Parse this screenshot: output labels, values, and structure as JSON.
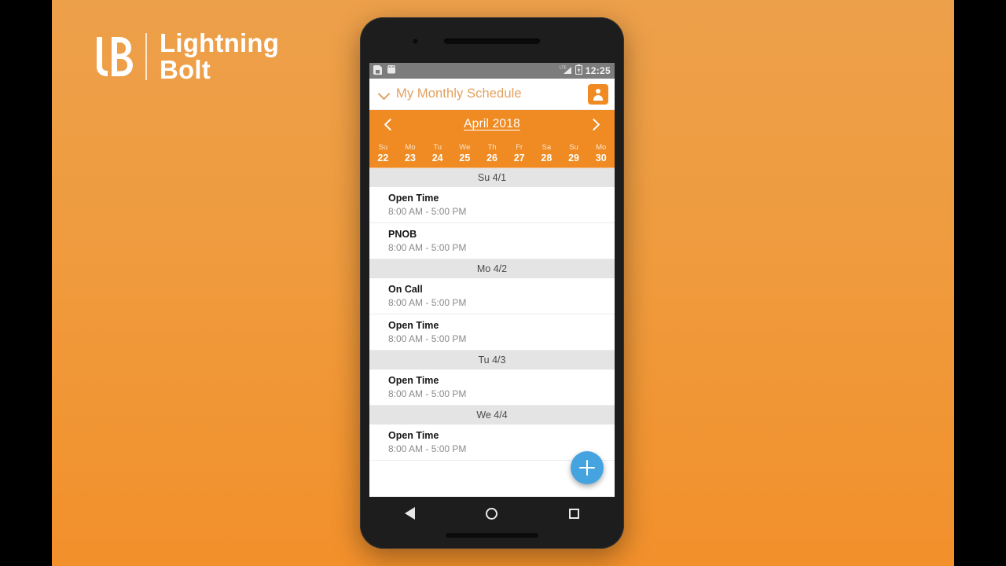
{
  "brand": {
    "name_line1": "Lightning",
    "name_line2": "Bolt",
    "logo_icon": "lightning-bolt-logo",
    "color": "#ffffff"
  },
  "theme": {
    "accent_orange": "#ef8b22",
    "backdrop_top": "#eda04a",
    "backdrop_bottom": "#f2902b",
    "fab_blue": "#45a3e0",
    "group_header_gray": "#e4e4e4"
  },
  "statusbar": {
    "notification_icons": [
      "sd-card-icon",
      "android-robot-icon"
    ],
    "network_label": "LTE",
    "signal_icon": "signal-bars-icon",
    "battery_icon": "battery-icon",
    "time": "12:25"
  },
  "appbar": {
    "dropdown_icon": "chevron-down-icon",
    "title": "My Monthly Schedule",
    "avatar_icon": "person-icon"
  },
  "monthbar": {
    "prev_icon": "chevron-left-icon",
    "month": "April 2018",
    "next_icon": "chevron-right-icon"
  },
  "daystrip": [
    {
      "dow": "Su",
      "day": "22"
    },
    {
      "dow": "Mo",
      "day": "23"
    },
    {
      "dow": "Tu",
      "day": "24"
    },
    {
      "dow": "We",
      "day": "25"
    },
    {
      "dow": "Th",
      "day": "26"
    },
    {
      "dow": "Fr",
      "day": "27"
    },
    {
      "dow": "Sa",
      "day": "28"
    },
    {
      "dow": "Su",
      "day": "29"
    },
    {
      "dow": "Mo",
      "day": "30"
    }
  ],
  "schedule": [
    {
      "header": "Su 4/1",
      "events": [
        {
          "title": "Open Time",
          "time": "8:00 AM - 5:00 PM"
        },
        {
          "title": "PNOB",
          "time": "8:00 AM - 5:00 PM"
        }
      ]
    },
    {
      "header": "Mo 4/2",
      "events": [
        {
          "title": "On Call",
          "time": "8:00 AM - 5:00 PM"
        },
        {
          "title": "Open Time",
          "time": "8:00 AM - 5:00 PM"
        }
      ]
    },
    {
      "header": "Tu 4/3",
      "events": [
        {
          "title": "Open Time",
          "time": "8:00 AM - 5:00 PM"
        }
      ]
    },
    {
      "header": "We 4/4",
      "events": [
        {
          "title": "Open Time",
          "time": "8:00 AM - 5:00 PM"
        }
      ]
    }
  ],
  "fab": {
    "icon": "plus-icon",
    "label": "+"
  },
  "android_nav": {
    "back_icon": "back-triangle-icon",
    "home_icon": "home-circle-icon",
    "recents_icon": "recents-square-icon"
  }
}
